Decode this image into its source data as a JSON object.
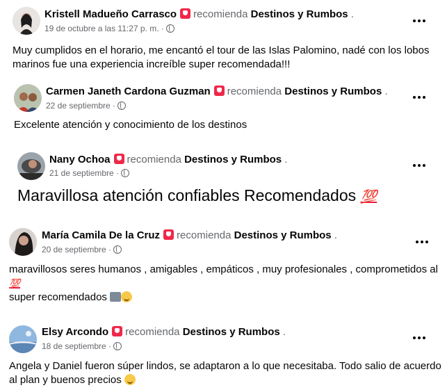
{
  "reviews": [
    {
      "name": "Kristell Madueño Carrasco",
      "verb": "recomienda",
      "page": "Destinos y Rumbos",
      "date": "19 de octubre a las 11:27 p. m. ·",
      "lines": [
        "Muy cumplidos en el horario, me encantó el tour de las Islas Palomino, nadé con los lobos",
        "marinos fue una experiencia increíble super recomendada!!!"
      ],
      "avatar_color": "#3a3a3a"
    },
    {
      "name": "Carmen Janeth Cardona Guzman",
      "verb": "recomienda",
      "page": "Destinos y Rumbos",
      "date": "22 de septiembre ·",
      "lines": [
        "Excelente atención y conocimiento de los destinos"
      ],
      "avatar_color": "#8a5a3c"
    },
    {
      "name": "Nany Ochoa",
      "verb": "recomienda",
      "page": "Destinos y Rumbos",
      "date": "21 de septiembre ·",
      "lines": [
        "Maravillosa atención confiables Recomendados"
      ],
      "emoji": "💯",
      "avatar_color": "#4a4a4a"
    },
    {
      "name": "María Camila De la Cruz",
      "verb": "recomienda",
      "page": "Destinos y Rumbos",
      "date": "20 de septiembre ·",
      "lines": [
        "maravillosos seres humanos , amigables , empáticos , muy profesionales , comprometidos al",
        "super recomendados"
      ],
      "emoji": "💯",
      "avatar_color": "#2e2a2a"
    },
    {
      "name": "Elsy Arcondo",
      "verb": "recomienda",
      "page": "Destinos y Rumbos",
      "date": "18 de septiembre ·",
      "lines": [
        "Angela y Daniel fueron súper lindos, se adaptaron a lo que necesitaba. Todo salio de acuerdo",
        "al plan y buenos precios"
      ],
      "avatar_color": "#6f9fcf"
    }
  ],
  "colors": {
    "recommend_badge": "#f0284a",
    "secondary_text": "#65676b",
    "primary_text": "#050505"
  }
}
